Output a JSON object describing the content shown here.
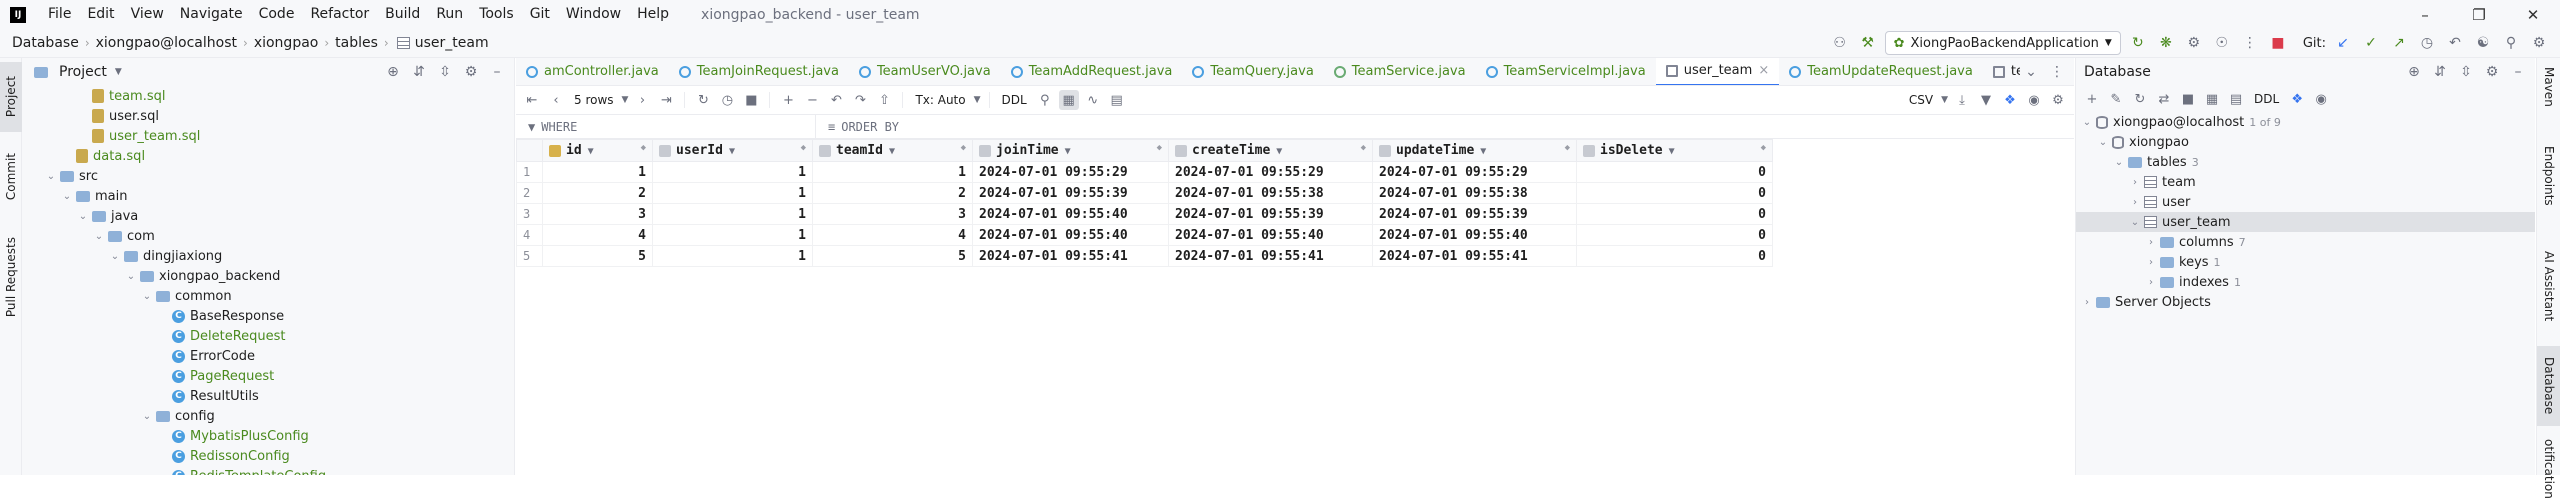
{
  "menu": {
    "items": [
      "File",
      "Edit",
      "View",
      "Navigate",
      "Code",
      "Refactor",
      "Build",
      "Run",
      "Tools",
      "Git",
      "Window",
      "Help"
    ],
    "title": "xiongpao_backend - user_team"
  },
  "breadcrumb": [
    "Database",
    "xiongpao@localhost",
    "xiongpao",
    "tables",
    "user_team"
  ],
  "toolbar": {
    "run_config": "XiongPaoBackendApplication",
    "git_label": "Git:"
  },
  "left_strip": {
    "tabs": [
      "Project",
      "Commit",
      "Pull Requests"
    ]
  },
  "project": {
    "title": "Project",
    "tree": [
      {
        "label": "team.sql",
        "indent": 3,
        "icon": "sql",
        "color": "green"
      },
      {
        "label": "user.sql",
        "indent": 3,
        "icon": "sql",
        "color": ""
      },
      {
        "label": "user_team.sql",
        "indent": 3,
        "icon": "sql",
        "color": "green"
      },
      {
        "label": "data.sql",
        "indent": 2,
        "icon": "sql",
        "color": "green"
      },
      {
        "label": "src",
        "indent": 1,
        "icon": "folder",
        "arrow": "down"
      },
      {
        "label": "main",
        "indent": 2,
        "icon": "folder",
        "arrow": "down"
      },
      {
        "label": "java",
        "indent": 3,
        "icon": "folder",
        "arrow": "down"
      },
      {
        "label": "com",
        "indent": 4,
        "icon": "folder",
        "arrow": "down"
      },
      {
        "label": "dingjiaxiong",
        "indent": 5,
        "icon": "folder",
        "arrow": "down"
      },
      {
        "label": "xiongpao_backend",
        "indent": 6,
        "icon": "folder",
        "arrow": "down"
      },
      {
        "label": "common",
        "indent": 7,
        "icon": "folder",
        "arrow": "down"
      },
      {
        "label": "BaseResponse",
        "indent": 8,
        "icon": "class",
        "color": ""
      },
      {
        "label": "DeleteRequest",
        "indent": 8,
        "icon": "class",
        "color": "green"
      },
      {
        "label": "ErrorCode",
        "indent": 8,
        "icon": "class",
        "color": ""
      },
      {
        "label": "PageRequest",
        "indent": 8,
        "icon": "class",
        "color": "green"
      },
      {
        "label": "ResultUtils",
        "indent": 8,
        "icon": "class",
        "color": ""
      },
      {
        "label": "config",
        "indent": 7,
        "icon": "folder",
        "arrow": "down"
      },
      {
        "label": "MybatisPlusConfig",
        "indent": 8,
        "icon": "class",
        "color": "green"
      },
      {
        "label": "RedissonConfig",
        "indent": 8,
        "icon": "class",
        "color": "green"
      },
      {
        "label": "RedisTemplateConfig",
        "indent": 8,
        "icon": "class",
        "color": "green"
      }
    ]
  },
  "editor": {
    "tabs": [
      {
        "label": "amController.java",
        "icon": "class",
        "color": "green"
      },
      {
        "label": "TeamJoinRequest.java",
        "icon": "class",
        "color": "green"
      },
      {
        "label": "TeamUserVO.java",
        "icon": "class",
        "color": "green"
      },
      {
        "label": "TeamAddRequest.java",
        "icon": "class",
        "color": "green"
      },
      {
        "label": "TeamQuery.java",
        "icon": "class",
        "color": "green"
      },
      {
        "label": "TeamService.java",
        "icon": "iface",
        "color": "green"
      },
      {
        "label": "TeamServiceImpl.java",
        "icon": "class",
        "color": "green"
      },
      {
        "label": "user_team",
        "icon": "grid",
        "color": "",
        "active": true
      },
      {
        "label": "TeamUpdateRequest.java",
        "icon": "class",
        "color": "green"
      },
      {
        "label": "team",
        "icon": "grid",
        "color": ""
      }
    ],
    "rows_label": "5 rows",
    "tx_label": "Tx: Auto",
    "ddl_label": "DDL",
    "export_label": "CSV",
    "where_label": "WHERE",
    "order_label": "ORDER BY"
  },
  "table": {
    "columns": [
      "id",
      "userId",
      "teamId",
      "joinTime",
      "createTime",
      "updateTime",
      "isDelete"
    ],
    "rows": [
      [
        "1",
        "1",
        "1",
        "1",
        "2024-07-01 09:55:29",
        "2024-07-01 09:55:29",
        "2024-07-01 09:55:29",
        "0"
      ],
      [
        "2",
        "2",
        "1",
        "2",
        "2024-07-01 09:55:39",
        "2024-07-01 09:55:38",
        "2024-07-01 09:55:38",
        "0"
      ],
      [
        "3",
        "3",
        "1",
        "3",
        "2024-07-01 09:55:40",
        "2024-07-01 09:55:39",
        "2024-07-01 09:55:39",
        "0"
      ],
      [
        "4",
        "4",
        "1",
        "4",
        "2024-07-01 09:55:40",
        "2024-07-01 09:55:40",
        "2024-07-01 09:55:40",
        "0"
      ],
      [
        "5",
        "5",
        "1",
        "5",
        "2024-07-01 09:55:41",
        "2024-07-01 09:55:41",
        "2024-07-01 09:55:41",
        "0"
      ]
    ]
  },
  "database": {
    "title": "Database",
    "ddl_label": "DDL",
    "tree": [
      {
        "label": "xiongpao@localhost",
        "count": "1 of 9",
        "indent": 0,
        "icon": "db",
        "arrow": "down"
      },
      {
        "label": "xiongpao",
        "count": "",
        "indent": 1,
        "icon": "db",
        "arrow": "down"
      },
      {
        "label": "tables",
        "count": "3",
        "indent": 2,
        "icon": "folder",
        "arrow": "down"
      },
      {
        "label": "team",
        "count": "",
        "indent": 3,
        "icon": "table",
        "arrow": "right"
      },
      {
        "label": "user",
        "count": "",
        "indent": 3,
        "icon": "table",
        "arrow": "right"
      },
      {
        "label": "user_team",
        "count": "",
        "indent": 3,
        "icon": "table",
        "arrow": "down",
        "selected": true
      },
      {
        "label": "columns",
        "count": "7",
        "indent": 4,
        "icon": "folder",
        "arrow": "right"
      },
      {
        "label": "keys",
        "count": "1",
        "indent": 4,
        "icon": "folder",
        "arrow": "right"
      },
      {
        "label": "indexes",
        "count": "1",
        "indent": 4,
        "icon": "folder",
        "arrow": "right"
      },
      {
        "label": "Server Objects",
        "count": "",
        "indent": 0,
        "icon": "folder",
        "arrow": "right"
      }
    ]
  },
  "right_strip": {
    "tabs": [
      "Maven",
      "Endpoints",
      "AI Assistant",
      "Database",
      "Notifications"
    ]
  }
}
